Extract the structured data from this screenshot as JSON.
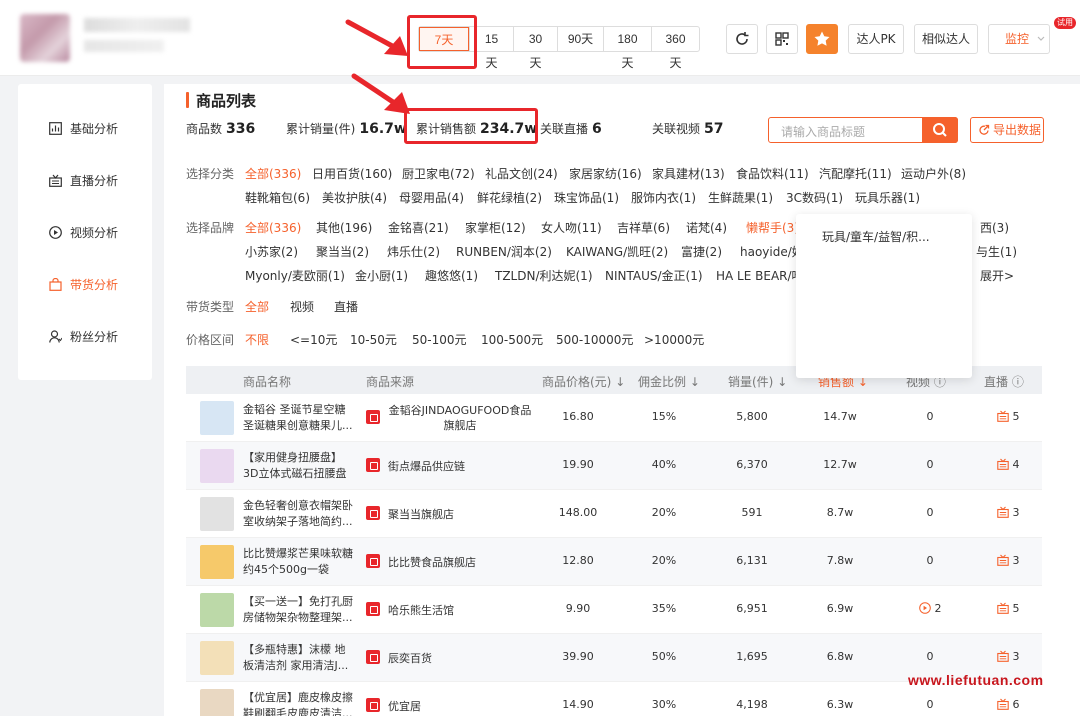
{
  "time_ranges": [
    "7天",
    "15天",
    "30天",
    "90天",
    "180天",
    "360天"
  ],
  "active_range": "7天",
  "header_buttons": {
    "pk": "达人PK",
    "similar": "相似达人",
    "monitor": "监控",
    "monitor_badge": "试用"
  },
  "sidebar": [
    {
      "label": "基础分析",
      "icon": "chart-icon"
    },
    {
      "label": "直播分析",
      "icon": "live-icon"
    },
    {
      "label": "视频分析",
      "icon": "play-icon"
    },
    {
      "label": "带货分析",
      "icon": "bag-icon",
      "active": true
    },
    {
      "label": "粉丝分析",
      "icon": "user-icon"
    }
  ],
  "section_title": "商品列表",
  "stats": {
    "product_count_label": "商品数",
    "product_count": "336",
    "sales_label": "累计销量(件)",
    "sales": "16.7w",
    "revenue_label": "累计销售额",
    "revenue": "234.7w",
    "live_label": "关联直播",
    "live": "6",
    "video_label": "关联视频",
    "video": "57"
  },
  "search_placeholder": "请输入商品标题",
  "export_label": "导出数据",
  "filters": {
    "category_label": "选择分类",
    "category_row1": [
      "全部(336)",
      "日用百货(160)",
      "厨卫家电(72)",
      "礼品文创(24)",
      "家居家纺(16)",
      "家具建材(13)",
      "食品饮料(11)",
      "汽配摩托(11)",
      "运动户外(8)"
    ],
    "category_row2": [
      "鞋靴箱包(6)",
      "美妆护肤(4)",
      "母婴用品(4)",
      "鲜花绿植(2)",
      "珠宝饰品(1)",
      "服饰内衣(1)",
      "生鲜蔬果(1)",
      "3C数码(1)",
      "玩具乐器(1)"
    ],
    "brand_label": "选择品牌",
    "brand_row1": [
      "全部(336)",
      "其他(196)",
      "金铭喜(21)",
      "家掌柜(12)",
      "女人吻(11)",
      "吉祥草(6)",
      "诺梵(4)",
      "懒帮手(3)",
      "西(3)"
    ],
    "brand_row2": [
      "小苏家(2)",
      "聚当当(2)",
      "炜乐仕(2)",
      "RUNBEN/润本(2)",
      "KAIWANG/凯旺(2)",
      "富捷(2)",
      "haoyide/好",
      "与生(1)"
    ],
    "brand_row3": [
      "Myonly/麦欧丽(1)",
      "金小厨(1)",
      "趣悠悠(1)",
      "TZLDN/利达妮(1)",
      "NINTAUS/金正(1)",
      "HA LE BEAR/哈",
      "展开>"
    ],
    "type_label": "带货类型",
    "types": [
      "全部",
      "视频",
      "直播"
    ],
    "price_label": "价格区间",
    "prices": [
      "不限",
      "<=10元",
      "10-50元",
      "50-100元",
      "100-500元",
      "500-10000元",
      ">10000元"
    ]
  },
  "popup_item": "玩具/童车/益智/积...",
  "table": {
    "headers": [
      "商品名称",
      "商品来源",
      "商品价格(元)",
      "佣金比例",
      "销量(件)",
      "销售额",
      "视频",
      "直播"
    ],
    "rows": [
      {
        "name": "金韬谷 圣诞节星空糖圣诞糖果创意糖果儿...",
        "shop": "金韬谷JINDAOGUFOOD食品旗舰店",
        "price": "16.80",
        "commission": "15%",
        "sales": "5,800",
        "revenue": "14.7w",
        "video": "0",
        "live": "5",
        "video_icon": false,
        "thumb": "#d7e6f4"
      },
      {
        "name": "【家用健身扭腰盘】3D立体式磁石扭腰盘 ...",
        "shop": "街点爆品供应链",
        "price": "19.90",
        "commission": "40%",
        "sales": "6,370",
        "revenue": "12.7w",
        "video": "0",
        "live": "4",
        "video_icon": false,
        "thumb": "#ead9f0"
      },
      {
        "name": "金色轻奢创意衣帽架卧室收纳架子落地简约...",
        "shop": "聚当当旗舰店",
        "price": "148.00",
        "commission": "20%",
        "sales": "591",
        "revenue": "8.7w",
        "video": "0",
        "live": "3",
        "video_icon": false,
        "thumb": "#e2e2e2"
      },
      {
        "name": "比比赞爆浆芒果味软糖约45个500g一袋",
        "shop": "比比赞食品旗舰店",
        "price": "12.80",
        "commission": "20%",
        "sales": "6,131",
        "revenue": "7.8w",
        "video": "0",
        "live": "3",
        "video_icon": false,
        "thumb": "#f6c96a"
      },
      {
        "name": "【买一送一】免打孔厨房储物架杂物整理架...",
        "shop": "哈乐熊生活馆",
        "price": "9.90",
        "commission": "35%",
        "sales": "6,951",
        "revenue": "6.9w",
        "video": "2",
        "live": "5",
        "video_icon": true,
        "thumb": "#bcd9a8"
      },
      {
        "name": "【多瓶特惠】沫檬 地板清洁剂 家用清洁J...",
        "shop": "辰奕百货",
        "price": "39.90",
        "commission": "50%",
        "sales": "1,695",
        "revenue": "6.8w",
        "video": "0",
        "live": "3",
        "video_icon": false,
        "thumb": "#f3e0b8"
      },
      {
        "name": "【优宜居】鹿皮橡皮擦鞋刷翻毛皮鹿皮清洁...",
        "shop": "优宜居",
        "price": "14.90",
        "commission": "30%",
        "sales": "4,198",
        "revenue": "6.3w",
        "video": "0",
        "live": "6",
        "video_icon": false,
        "thumb": "#e9d8c2"
      }
    ]
  },
  "watermark": "www.liefutuan.com",
  "colors": {
    "accent": "#f5612c",
    "highlight": "#e8262b"
  }
}
